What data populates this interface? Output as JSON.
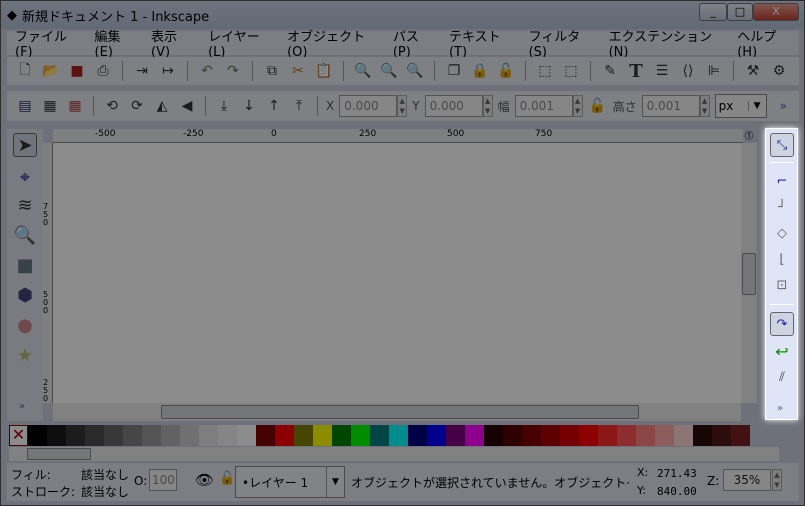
{
  "window": {
    "title": "新規ドキュメント 1 - Inkscape",
    "minimize": "_",
    "maximize": "□",
    "close": "X"
  },
  "menu": [
    "ファイル(F)",
    "編集(E)",
    "表示(V)",
    "レイヤー(L)",
    "オブジェクト(O)",
    "パス(P)",
    "テキスト(T)",
    "フィルタ(S)",
    "エクステンション(N)",
    "ヘルプ(H)"
  ],
  "toolbar": {
    "x_label": "X",
    "x": "0.000",
    "y_label": "Y",
    "y": "0.000",
    "w_label": "幅",
    "w": "0.001",
    "h_label": "高さ",
    "h": "0.001",
    "unit": "px",
    "overflow": "»"
  },
  "rulers": {
    "top": [
      "-500",
      "-250",
      "0",
      "250",
      "500",
      "750"
    ],
    "left": [
      "750",
      "500",
      "250"
    ]
  },
  "toolbox_more": "»",
  "snap_more": "»",
  "palette": [
    "#000000",
    "#1a1a1a",
    "#333333",
    "#4d4d4d",
    "#666666",
    "#808080",
    "#999999",
    "#b3b3b3",
    "#cccccc",
    "#e6e6e6",
    "#f2f2f2",
    "#ffffff",
    "#800000",
    "#ff0000",
    "#808000",
    "#ffff00",
    "#008000",
    "#00ff00",
    "#008080",
    "#00ffff",
    "#000080",
    "#0000ff",
    "#800080",
    "#ff00ff",
    "#2b0000",
    "#550000",
    "#800000",
    "#aa0000",
    "#d40000",
    "#ff0000",
    "#ff2a2a",
    "#ff5555",
    "#ff8080",
    "#ffaaaa",
    "#ffd5d5",
    "#280b0b",
    "#501616",
    "#782121"
  ],
  "status": {
    "fill_label": "フィル:",
    "fill_value": "該当なし",
    "stroke_label": "ストローク:",
    "stroke_value": "該当なし",
    "opacity_label": "O:",
    "opacity": "100",
    "layer": "•レイヤー 1",
    "message": "オブジェクトが選択されていません。オブジェクト·",
    "x_label": "X:",
    "x": "271.43",
    "y_label": "Y:",
    "y": "840.00",
    "zoom_label": "Z:",
    "zoom": "35%"
  }
}
